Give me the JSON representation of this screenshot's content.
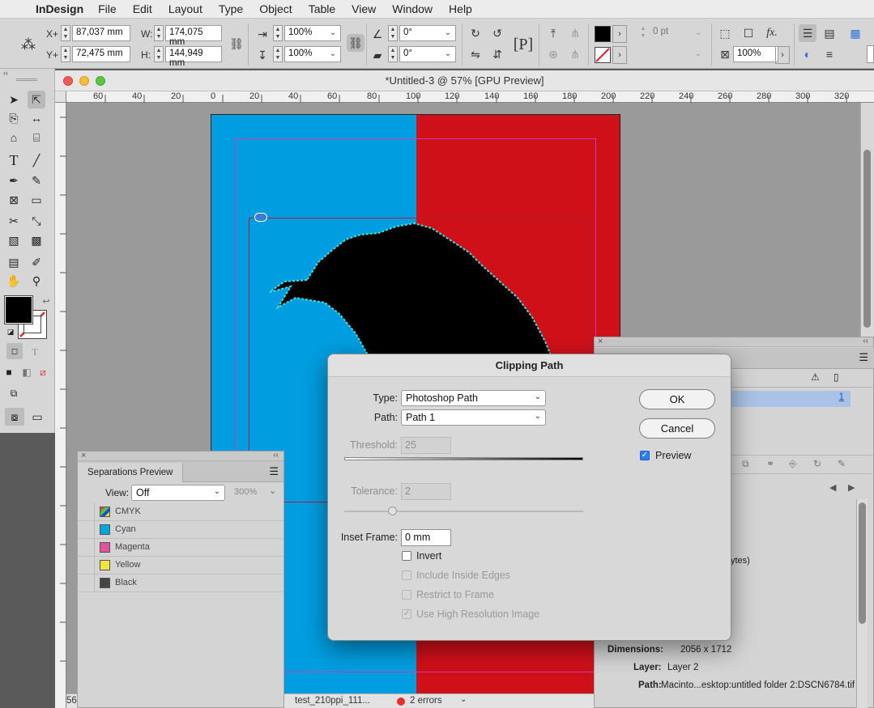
{
  "menubar": {
    "app": "InDesign",
    "items": [
      "File",
      "Edit",
      "Layout",
      "Type",
      "Object",
      "Table",
      "View",
      "Window",
      "Help"
    ]
  },
  "control": {
    "x_label": "X+",
    "x_value": "87,037 mm",
    "y_label": "Y+",
    "y_value": "72,475 mm",
    "w_label": "W:",
    "w_value": "174,075 mm",
    "h_label": "H:",
    "h_value": "144,949 mm",
    "scale_x": "100%",
    "scale_y": "100%",
    "angle": "0°",
    "shear": "0°",
    "stroke_weight": "0 pt",
    "opacity": "100%"
  },
  "document": {
    "title": "*Untitled-3 @ 57% [GPU Preview]",
    "ruler_ticks": [
      "60",
      "40",
      "20",
      "0",
      "20",
      "40",
      "60",
      "80",
      "100",
      "120",
      "140",
      "160",
      "180",
      "200",
      "220",
      "240",
      "260",
      "280",
      "300",
      "320"
    ],
    "status": {
      "page": "56",
      "filename": "test_210ppi_111...",
      "errors": "2 errors"
    }
  },
  "separations": {
    "tab": "Separations Preview",
    "view_label": "View:",
    "view_value": "Off",
    "zoom": "300%",
    "inks": [
      {
        "name": "CMYK",
        "color": "#aaaaaa"
      },
      {
        "name": "Cyan",
        "color": "#00a6d6"
      },
      {
        "name": "Magenta",
        "color": "#e0529c"
      },
      {
        "name": "Yellow",
        "color": "#f2e440"
      },
      {
        "name": "Black",
        "color": "#444444"
      }
    ]
  },
  "links": {
    "selected_number": "1",
    "size_fragment": "ytes)",
    "dimensions_label": "Dimensions:",
    "dimensions_value": "2056 x 1712",
    "layer_label": "Layer:",
    "layer_value": "Layer 2",
    "path_label": "Path:",
    "path_value": "Macinto...esktop:untitled folder 2:DSCN6784.tif"
  },
  "dialog": {
    "title": "Clipping Path",
    "type_label": "Type:",
    "type_value": "Photoshop Path",
    "path_label": "Path:",
    "path_value": "Path 1",
    "threshold_label": "Threshold:",
    "threshold_value": "25",
    "tolerance_label": "Tolerance:",
    "tolerance_value": "2",
    "inset_label": "Inset Frame:",
    "inset_value": "0 mm",
    "invert_label": "Invert",
    "include_inside_label": "Include Inside Edges",
    "restrict_label": "Restrict to Frame",
    "high_res_label": "Use High Resolution Image",
    "ok_label": "OK",
    "cancel_label": "Cancel",
    "preview_label": "Preview"
  },
  "colors": {
    "page_blue": "#009ee0",
    "page_red": "#d01018",
    "path_highlight": "#40e0e0"
  }
}
